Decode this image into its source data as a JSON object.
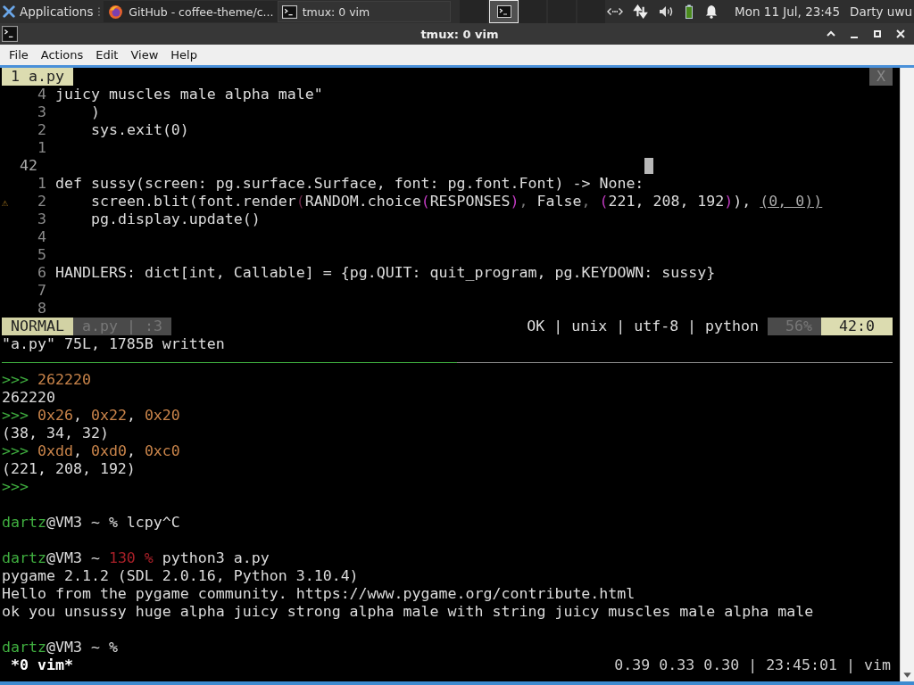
{
  "panel": {
    "apps_label": "Applications",
    "tasks": [
      {
        "title": "GitHub - coffee-theme/c...",
        "selected": false
      },
      {
        "title": "tmux: 0 vim",
        "selected": true
      }
    ],
    "pager": [
      {
        "selected": false
      },
      {
        "selected": true
      },
      {
        "selected": false
      },
      {
        "selected": false
      },
      {
        "selected": false
      }
    ],
    "clock": "Mon 11 Jul, 23:45",
    "user": "Darty uwu"
  },
  "window": {
    "title": "tmux: 0 vim"
  },
  "menu": [
    "File",
    "Actions",
    "Edit",
    "View",
    "Help"
  ],
  "vim": {
    "tab": "1 a.py",
    "close": "X",
    "lines": [
      {
        "number": "4",
        "current": false,
        "segments": [
          {
            "text": "juicy muscles male alpha male\"",
            "kind": "plain"
          }
        ]
      },
      {
        "number": "3",
        "current": false,
        "segments": [
          {
            "text": "    )",
            "kind": "plain"
          }
        ]
      },
      {
        "number": "2",
        "current": false,
        "segments": [
          {
            "text": "    sys.exit(0)",
            "kind": "plain"
          }
        ]
      },
      {
        "number": "1",
        "current": false
      },
      {
        "number": "42",
        "current": true
      },
      {
        "number": "1",
        "current": false,
        "segments": [
          {
            "text": "def sussy(screen: pg.surface.Surface, font: pg.font.Font) -> None:",
            "kind": "plain"
          }
        ]
      },
      {
        "number": "2",
        "current": false,
        "sign": "⚠",
        "segments": [
          {
            "text": "    screen.blit(font.render",
            "kind": "plain"
          },
          {
            "text": "(",
            "kind": "dimbracket"
          },
          {
            "text": "RANDOM.choice",
            "kind": "plain"
          },
          {
            "text": "(",
            "kind": "bracket"
          },
          {
            "text": "RESPONSES",
            "kind": "plain"
          },
          {
            "text": ")",
            "kind": "bracket"
          },
          {
            "text": ", ",
            "kind": "dim"
          },
          {
            "text": "False",
            "kind": "plain"
          },
          {
            "text": ", ",
            "kind": "dim"
          },
          {
            "text": "(",
            "kind": "bracket"
          },
          {
            "text": "221, 208, 192",
            "kind": "plain"
          },
          {
            "text": ")",
            "kind": "bracket"
          },
          {
            "text": "), ",
            "kind": "plain"
          },
          {
            "text": "(0, 0))",
            "kind": "underline"
          }
        ]
      },
      {
        "number": "3",
        "current": false,
        "segments": [
          {
            "text": "    pg.display.update()",
            "kind": "plain"
          }
        ]
      },
      {
        "number": "4",
        "current": false
      },
      {
        "number": "5",
        "current": false
      },
      {
        "number": "6",
        "current": false,
        "segments": [
          {
            "text": "HANDLERS: dict[int, Callable] = {pg.QUIT: quit_program, pg.KEYDOWN: sussy}",
            "kind": "plain"
          }
        ]
      },
      {
        "number": "7",
        "current": false
      },
      {
        "number": "8",
        "current": false
      }
    ],
    "status": {
      "mode": "NORMAL",
      "file": "a.py | :3",
      "info": "OK | unix | utf-8 | python",
      "percent": "56%",
      "position": "42:0"
    },
    "message": "\"a.py\" 75L, 1785B written"
  },
  "shell": [
    {
      "segments": [
        {
          "text": ">>> ",
          "kind": "prompt"
        },
        {
          "text": "262220",
          "kind": "input"
        }
      ]
    },
    {
      "segments": [
        {
          "text": "262220",
          "kind": "output"
        }
      ]
    },
    {
      "segments": [
        {
          "text": ">>> ",
          "kind": "prompt"
        },
        {
          "text": "0x26",
          "kind": "input"
        },
        {
          "text": ", ",
          "kind": "output"
        },
        {
          "text": "0x22",
          "kind": "input"
        },
        {
          "text": ", ",
          "kind": "output"
        },
        {
          "text": "0x20",
          "kind": "input"
        }
      ]
    },
    {
      "segments": [
        {
          "text": "(38, 34, 32)",
          "kind": "output"
        }
      ]
    },
    {
      "segments": [
        {
          "text": ">>> ",
          "kind": "prompt"
        },
        {
          "text": "0xdd",
          "kind": "input"
        },
        {
          "text": ", ",
          "kind": "output"
        },
        {
          "text": "0xd0",
          "kind": "input"
        },
        {
          "text": ", ",
          "kind": "output"
        },
        {
          "text": "0xc0",
          "kind": "input"
        }
      ]
    },
    {
      "segments": [
        {
          "text": "(221, 208, 192)",
          "kind": "output"
        }
      ]
    },
    {
      "segments": [
        {
          "text": ">>>",
          "kind": "prompt"
        }
      ]
    },
    {
      "kind": "blank"
    },
    {
      "segments": [
        {
          "text": "dartz",
          "kind": "user"
        },
        {
          "text": "@VM3 ~ % lcpy^C",
          "kind": "output"
        }
      ]
    },
    {
      "kind": "blank"
    },
    {
      "segments": [
        {
          "text": "dartz",
          "kind": "user"
        },
        {
          "text": "@VM3 ~ ",
          "kind": "output"
        },
        {
          "text": "130 %",
          "kind": "error"
        },
        {
          "text": " python3 a.py",
          "kind": "output"
        }
      ]
    },
    {
      "segments": [
        {
          "text": "pygame 2.1.2 (SDL 2.0.16, Python 3.10.4)",
          "kind": "output"
        }
      ]
    },
    {
      "segments": [
        {
          "text": "Hello from the pygame community. https://www.pygame.org/contribute.html",
          "kind": "output"
        }
      ]
    },
    {
      "segments": [
        {
          "text": "ok you unsussy huge alpha juicy strong alpha male with string juicy muscles male alpha male",
          "kind": "output"
        }
      ]
    },
    {
      "kind": "blank"
    },
    {
      "segments": [
        {
          "text": "dartz",
          "kind": "user"
        },
        {
          "text": "@VM3 ~ %",
          "kind": "output"
        }
      ]
    }
  ],
  "tmux": {
    "window": "*0 vim*",
    "right": "0.39 0.33 0.30 | 23:45:01 | vim"
  }
}
